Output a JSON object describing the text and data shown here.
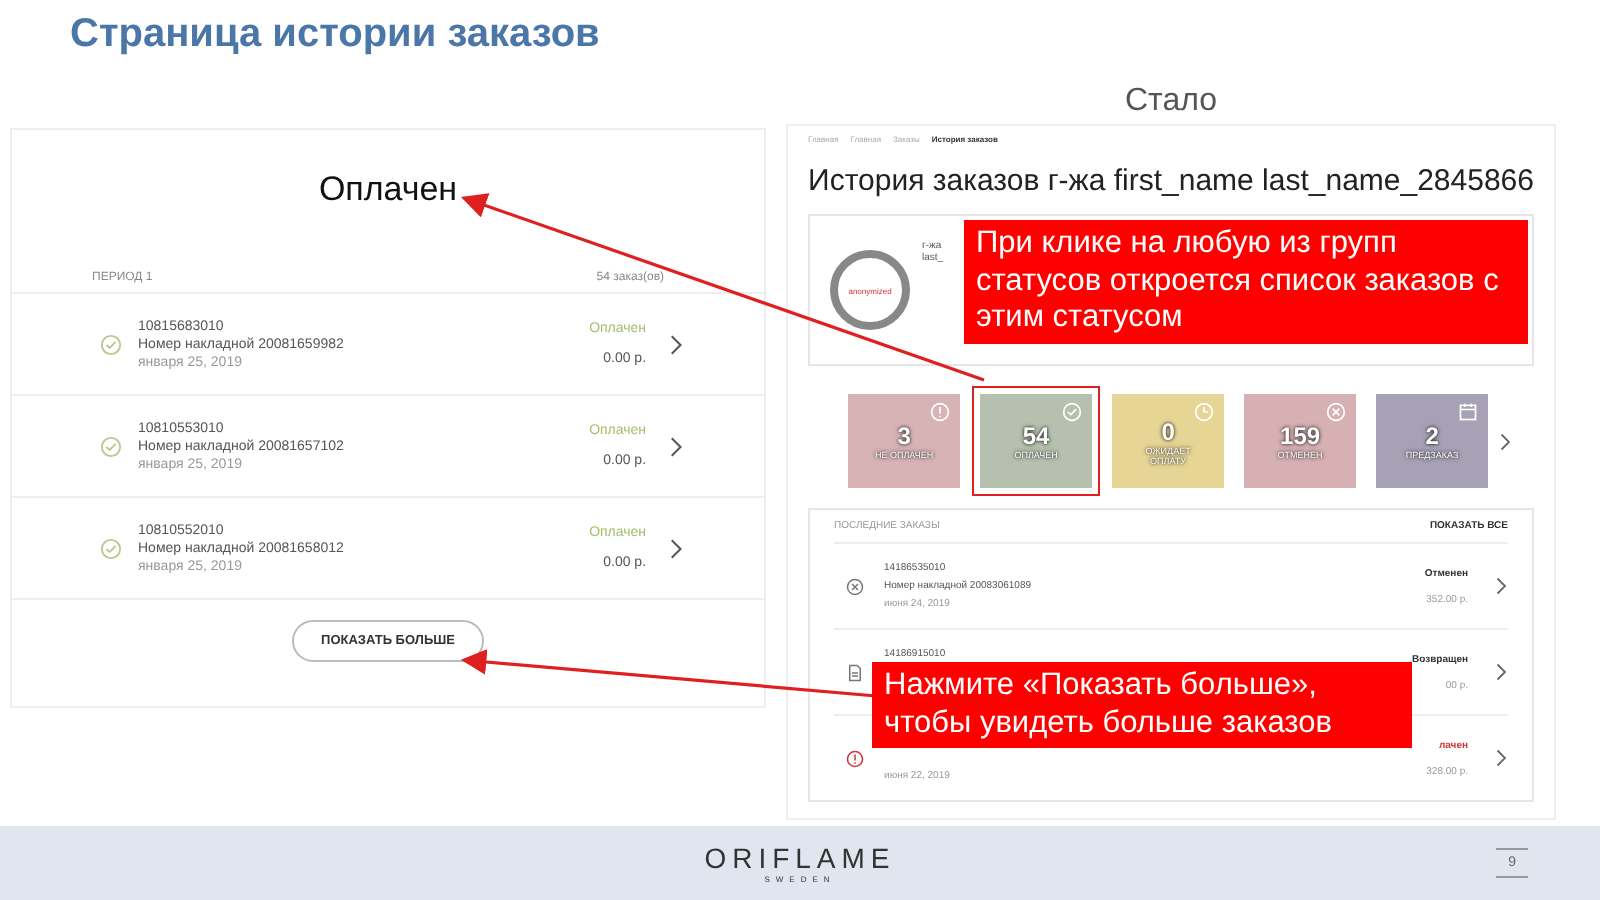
{
  "title": "Страница истории заказов",
  "before": {
    "heading": "Оплачен",
    "period": "ПЕРИОД 1",
    "count": "54 заказ(ов)",
    "orders": [
      {
        "number": "10815683010",
        "invoice": "Номер накладной 20081659982",
        "date": "января 25, 2019",
        "status": "Оплачен",
        "amount": "0.00 р."
      },
      {
        "number": "10810553010",
        "invoice": "Номер накладной 20081657102",
        "date": "января 25, 2019",
        "status": "Оплачен",
        "amount": "0.00 р."
      },
      {
        "number": "10810552010",
        "invoice": "Номер накладной 20081658012",
        "date": "января 25, 2019",
        "status": "Оплачен",
        "amount": "0.00 р."
      }
    ],
    "more_button": "ПОКАЗАТЬ БОЛЬШЕ"
  },
  "after": {
    "label": "Стало",
    "breadcrumbs": [
      {
        "label": "Главная",
        "current": false
      },
      {
        "label": "Главная",
        "current": false
      },
      {
        "label": "Заказы",
        "current": false
      },
      {
        "label": "История заказов",
        "current": true
      }
    ],
    "heading": "История заказов г-жа first_name last_name_2845866",
    "avatar_text": "anonymized",
    "profile_lines": [
      "г-жа",
      "last_"
    ],
    "status_tiles": [
      {
        "count": "3",
        "label": "НЕ ОПЛАЧЕН",
        "kind": "alert",
        "color": "#d8b3b6",
        "selected": false
      },
      {
        "count": "54",
        "label": "ОПЛАЧЕН",
        "kind": "check",
        "color": "#b5c1ae",
        "selected": true
      },
      {
        "count": "0",
        "label": "ОЖИДАЕТ ОПЛАТУ",
        "kind": "clock",
        "color": "#e6d595",
        "selected": false
      },
      {
        "count": "159",
        "label": "ОТМЕНЕН",
        "kind": "cancel",
        "color": "#d6b0b2",
        "selected": false
      },
      {
        "count": "2",
        "label": "ПРЕДЗАКАЗ",
        "kind": "calendar",
        "color": "#a7a1b6",
        "selected": false
      }
    ],
    "recent_title": "ПОСЛЕДНИЕ ЗАКАЗЫ",
    "show_all": "ПОКАЗАТЬ ВСЕ",
    "orders": [
      {
        "kind": "cancel",
        "number": "14186535010",
        "invoice": "Номер накладной 20083061089",
        "date": "июня 24, 2019",
        "status": "Отменен",
        "amount": "352.00 р.",
        "color": "#333333"
      },
      {
        "kind": "document",
        "number": "14186915010",
        "status": "Возвращен",
        "amount": "00 р.",
        "color": "#333333"
      },
      {
        "kind": "alert",
        "date": "июня 22, 2019",
        "status": "лачен",
        "amount": "328.00 р.",
        "color": "#d0343a"
      }
    ]
  },
  "callouts": [
    {
      "text": "При клике на любую из групп статусов откроется список заказов с этим статусом"
    },
    {
      "text": "Нажмите «Показать больше», чтобы увидеть больше заказов"
    }
  ],
  "footer": {
    "logo": "ORIFLAME",
    "logo_sub": "SWEDEN",
    "page": "9"
  }
}
